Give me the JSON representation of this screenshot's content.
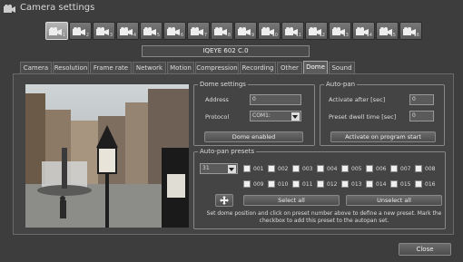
{
  "window": {
    "title": "Camera settings"
  },
  "cameras": [
    {
      "label": "1",
      "selected": true
    },
    {
      "label": "2"
    },
    {
      "label": "3"
    },
    {
      "label": "4"
    },
    {
      "label": "5"
    },
    {
      "label": "6"
    },
    {
      "label": "7"
    },
    {
      "label": "8"
    },
    {
      "label": "9"
    },
    {
      "label": "10"
    },
    {
      "label": "11"
    },
    {
      "label": "12"
    },
    {
      "label": "13"
    },
    {
      "label": "14"
    },
    {
      "label": "15"
    },
    {
      "label": "16"
    }
  ],
  "camera_name": "IQEYE 602 C.0",
  "tabs": [
    "Camera",
    "Resolution",
    "Frame rate",
    "Network",
    "Motion",
    "Compression",
    "Recording",
    "Other",
    "Dome",
    "Sound"
  ],
  "active_tab": "Dome",
  "dome_settings": {
    "legend": "Dome settings",
    "address_label": "Address",
    "address_value": "0",
    "protocol_label": "Protocol",
    "protocol_value": "COM1:",
    "button": "Dome enabled"
  },
  "autopan": {
    "legend": "Auto-pan",
    "activate_label": "Activate after [sec]",
    "activate_value": "0",
    "dwell_label": "Preset dwell time [sec]",
    "dwell_value": "0",
    "button": "Activate on program start"
  },
  "presets": {
    "legend": "Auto-pan presets",
    "selected": "31",
    "items": [
      "001",
      "002",
      "003",
      "004",
      "005",
      "006",
      "007",
      "008",
      "009",
      "010",
      "011",
      "012",
      "013",
      "014",
      "015",
      "016"
    ],
    "select_all": "Select all",
    "unselect_all": "Unselect all",
    "help": "Set dome position and click on preset number above to define a new preset. Mark the checkbox to add this preset to the autopan set."
  },
  "footer": {
    "close": "Close"
  }
}
